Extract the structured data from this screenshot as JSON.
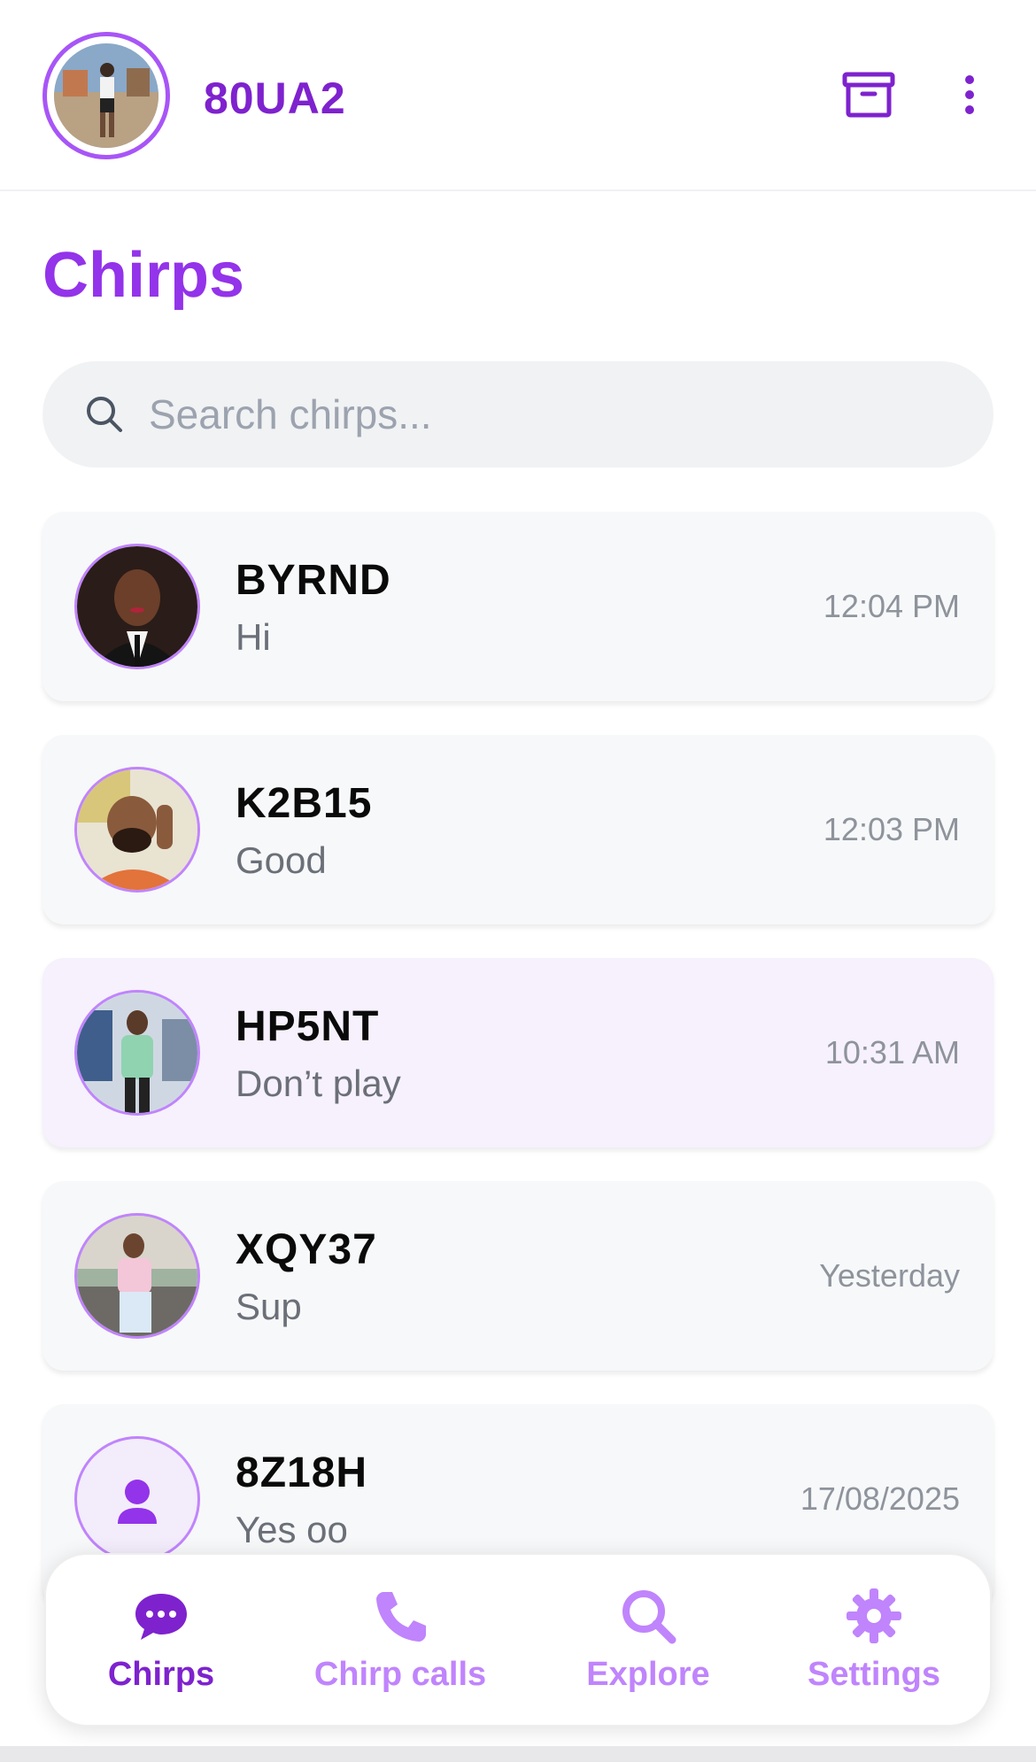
{
  "header": {
    "username": "80UA2",
    "archive_icon": "archive-box-icon",
    "more_icon": "more-vertical-icon"
  },
  "page": {
    "title": "Chirps"
  },
  "search": {
    "placeholder": "Search chirps...",
    "icon": "search-icon"
  },
  "chats": [
    {
      "name": "BYRND",
      "message": "Hi",
      "time": "12:04 PM"
    },
    {
      "name": "K2B15",
      "message": "Good",
      "time": "12:03 PM"
    },
    {
      "name": "HP5NT",
      "message": "Don’t play",
      "time": "10:31 AM"
    },
    {
      "name": "XQY37",
      "message": "Sup",
      "time": "Yesterday"
    },
    {
      "name": "8Z18H",
      "message": "Yes oo",
      "time": "17/08/2025"
    }
  ],
  "tabs": [
    {
      "label": "Chirps",
      "icon": "chat-bubble-icon",
      "active": true
    },
    {
      "label": "Chirp calls",
      "icon": "phone-icon",
      "active": false
    },
    {
      "label": "Explore",
      "icon": "search-icon",
      "active": false
    },
    {
      "label": "Settings",
      "icon": "gear-icon",
      "active": false
    }
  ],
  "colors": {
    "accent": "#9333ea",
    "accent_dark": "#7e22ce",
    "accent_light": "#c084fc",
    "active_row": "#f6f1fd"
  }
}
